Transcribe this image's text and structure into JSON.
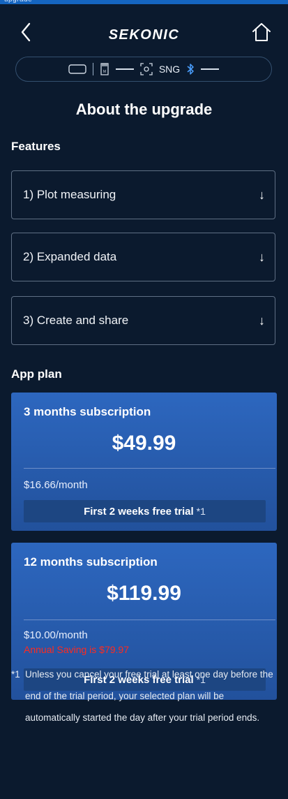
{
  "top_strip": {
    "text": "upgrade"
  },
  "nav": {
    "brand": "SEKONIC"
  },
  "status": {
    "mode": "SNG"
  },
  "page": {
    "title": "About the upgrade"
  },
  "features": {
    "label": "Features",
    "items": [
      {
        "label": "1) Plot measuring",
        "arrow": "↓"
      },
      {
        "label": "2) Expanded data",
        "arrow": "↓"
      },
      {
        "label": "3) Create and share",
        "arrow": "↓"
      }
    ]
  },
  "app_plan": {
    "label": "App plan",
    "plans": [
      {
        "name": "3 months subscription",
        "price": "$49.99",
        "monthly": "$16.66/month",
        "trial": "First 2 weeks free trial",
        "trial_note": "*1"
      },
      {
        "name": "12 months subscription",
        "price": "$119.99",
        "monthly": "$10.00/month",
        "saving": "Annual Saving is $79.97",
        "trial": "First 2 weeks free trial",
        "trial_note": "*1"
      }
    ]
  },
  "footnote": {
    "mark": "*1",
    "text": "Unless you cancel your free trial at least one day before the end of the trial period, your selected plan will be automatically started the day after your trial period ends."
  },
  "colors": {
    "background": "#0b1a2e",
    "plan_card": "#2d67bf",
    "saving": "#ff2a1f"
  }
}
